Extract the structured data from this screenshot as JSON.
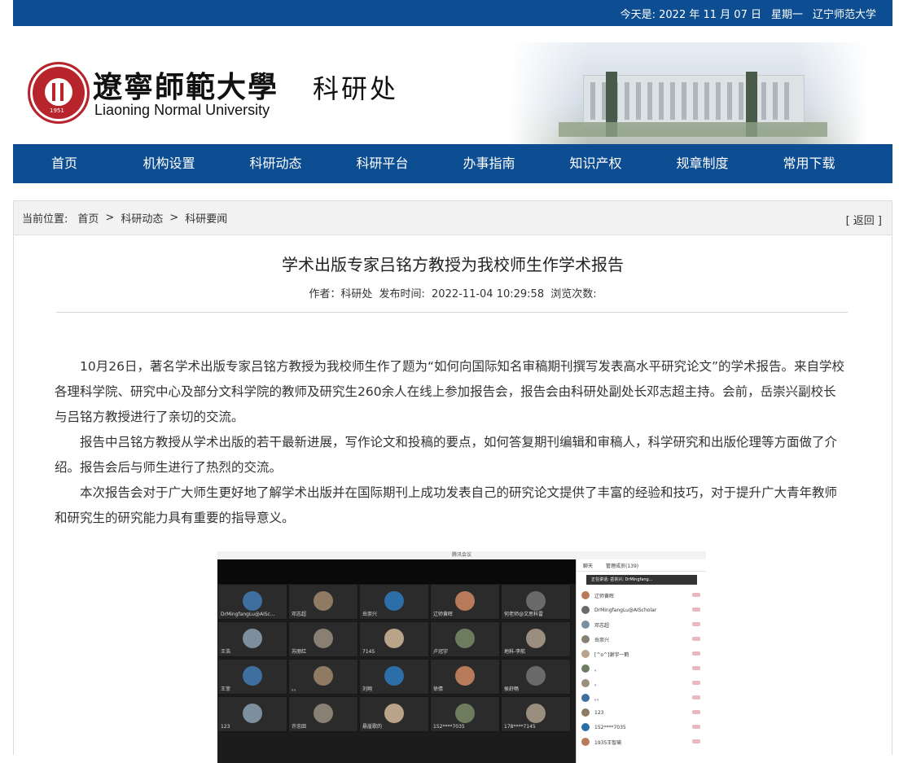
{
  "topbar": {
    "date_label": "今天是: 2022 年 11 月 07 日",
    "weekday": "星期一",
    "university_link": "辽宁师范大学"
  },
  "logo": {
    "cn_name": "遼寧師範大學",
    "en_name": "Liaoning Normal University",
    "department": "科研处",
    "seal_year": "1951"
  },
  "nav": {
    "items": [
      {
        "label": "首页"
      },
      {
        "label": "机构设置"
      },
      {
        "label": "科研动态"
      },
      {
        "label": "科研平台"
      },
      {
        "label": "办事指南"
      },
      {
        "label": "知识产权"
      },
      {
        "label": "规章制度"
      },
      {
        "label": "常用下载"
      }
    ]
  },
  "breadcrumb": {
    "lead": "当前位置:",
    "items": [
      "首页",
      "科研动态",
      "科研要闻"
    ],
    "separator": ">",
    "back": "[ 返回 ]"
  },
  "article": {
    "title": "学术出版专家吕铭方教授为我校师生作学术报告",
    "author_label": "作者：科研处",
    "publish_label": "发布时间:",
    "publish_time": "2022-11-04 10:29:58",
    "views_label": "浏览次数:",
    "paragraphs": [
      "10月26日，著名学术出版专家吕铭方教授为我校师生作了题为“如何向国际知名审稿期刊撰写发表高水平研究论文”的学术报告。来自学校各理科学院、研究中心及部分文科学院的教师及研究生260余人在线上参加报告会，报告会由科研处副处长邓志超主持。会前，岳崇兴副校长与吕铭方教授进行了亲切的交流。",
      "报告中吕铭方教授从学术出版的若干最新进展，写作论文和投稿的要点，如何答复期刊编辑和审稿人，科学研究和出版伦理等方面做了介绍。报告会后与师生进行了热烈的交流。",
      "本次报告会对于广大师生更好地了解学术出版并在国际期刊上成功发表自己的研究论文提供了丰富的经验和技巧，对于提升广大青年教师和研究生的研究能力具有重要的指导意义。"
    ]
  },
  "meeting": {
    "window_title": "腾讯会议",
    "tabs": [
      "聊天",
      "管理成员(139)"
    ],
    "notice": "正在讲话: 岳崇兴; DrMingfang...",
    "tiles": [
      "DrMingfangLu@AISc...",
      "邓志超",
      "岳崇兴",
      "辽师黄晖",
      "何老师@文思科雷",
      "王浩",
      "苏丽红",
      "7145",
      "卢冠宇",
      "地科-李航",
      "王菲",
      "。。",
      "刘翔",
      "徐倩",
      "侯舒畅",
      "123",
      "许忠田",
      "悬崖歌的",
      "152****7035",
      "178****7145"
    ],
    "members": [
      "辽师黄晖",
      "DrMingfangLu@AIScholar",
      "邓志超",
      "岳崇兴",
      "[^o^]谢宇一鹤",
      "。",
      "。",
      "。。",
      "123",
      "152****7035",
      "1935王智瑜"
    ]
  }
}
